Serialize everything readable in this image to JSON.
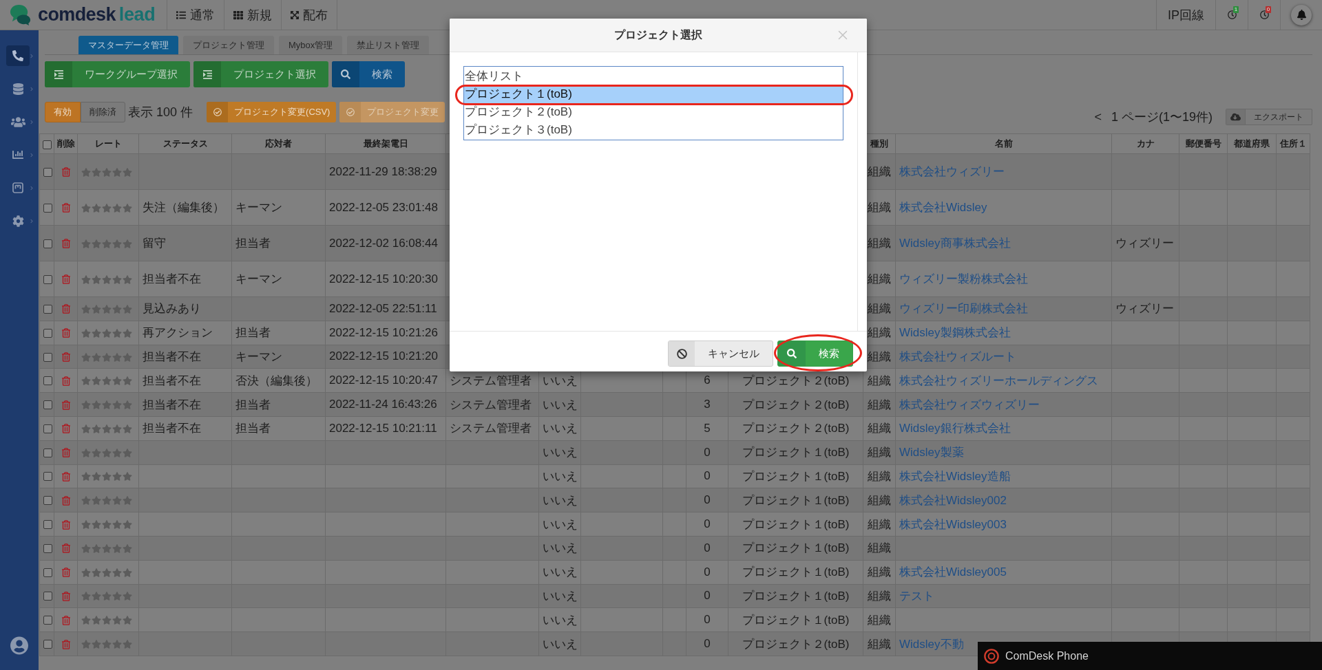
{
  "header": {
    "logo": {
      "brand": "comdesk",
      "product": "lead"
    },
    "nav": [
      {
        "label": "通常"
      },
      {
        "label": "新規"
      },
      {
        "label": "配布"
      }
    ],
    "line_button": "IP回線",
    "timers": [
      {
        "count": "1",
        "color": "#2f8f3f"
      },
      {
        "count": "0",
        "color": "#b53131"
      }
    ]
  },
  "sidebar": {
    "items": [
      {
        "selected": true
      },
      {
        "selected": false
      },
      {
        "selected": false
      },
      {
        "selected": false
      },
      {
        "selected": false
      },
      {
        "selected": false
      }
    ]
  },
  "tabs": [
    {
      "label": "マスターデータ管理",
      "selected": true
    },
    {
      "label": "プロジェクト管理",
      "selected": false
    },
    {
      "label": "Mybox管理",
      "selected": false
    },
    {
      "label": "禁止リスト管理",
      "selected": false
    }
  ],
  "toolbar": {
    "buttons": [
      {
        "label": "ワークグループ選択",
        "kind": "select"
      },
      {
        "label": "プロジェクト選択",
        "kind": "select"
      },
      {
        "label": "検索",
        "kind": "search"
      }
    ]
  },
  "filter_bar": {
    "record_states": [
      {
        "label": "有効",
        "selected": true
      },
      {
        "label": "削除済",
        "selected": false
      }
    ],
    "page_size": "表示 100 件",
    "actions": [
      {
        "label": "プロジェクト変更(CSV)",
        "disabled": false
      },
      {
        "label": "プロジェクト変更",
        "disabled": true
      }
    ],
    "pagination": {
      "prev": "<",
      "label": "1 ページ(1〜19件)"
    },
    "export": "エクスポート"
  },
  "table": {
    "select_all": {
      "checked": false
    },
    "columns": [
      "削除",
      "レート",
      "ステータス",
      "応対者",
      "最終架電日",
      "種別",
      "名前",
      "カナ",
      "郵便番号",
      "都道府県",
      "住所１"
    ],
    "rows": [
      {
        "checked": false,
        "stars": 0,
        "last_call": "2022-11-29 18:38:29",
        "type": "組織",
        "name": "株式会社ウィズリー"
      },
      {
        "checked": false,
        "stars": 0,
        "status": "失注（編集後）",
        "responder": "キーマン",
        "last_call": "2022-12-05 23:01:48",
        "type": "組織",
        "name": "株式会社Widsley"
      },
      {
        "checked": false,
        "stars": 0,
        "status": "留守",
        "responder": "担当者",
        "last_call": "2022-12-02 16:08:44",
        "type": "組織",
        "name": "Widsley商事株式会社",
        "kana": "ウィズリー"
      },
      {
        "checked": false,
        "stars": 0,
        "status": "担当者不在",
        "responder": "キーマン",
        "last_call": "2022-12-15 10:20:30",
        "type": "組織",
        "name": "ウィズリー製粉株式会社"
      },
      {
        "checked": false,
        "stars": 0,
        "status": "見込みあり",
        "last_call": "2022-12-05 22:51:11",
        "type": "組織",
        "name": "ウィズリー印刷株式会社",
        "kana": "ウィズリー"
      },
      {
        "checked": false,
        "stars": 0,
        "status": "再アクション",
        "responder": "担当者",
        "last_call": "2022-12-15 10:21:26",
        "type": "組織",
        "name": "Widsley製鋼株式会社"
      },
      {
        "checked": false,
        "stars": 0,
        "status": "担当者不在",
        "responder": "キーマン",
        "last_call": "2022-12-15 10:21:20",
        "type": "組織",
        "name": "株式会社ウィズルート"
      },
      {
        "checked": false,
        "stars": 0,
        "status": "担当者不在",
        "responder": "否決（編集後）",
        "last_call": "2022-12-15 10:20:47",
        "column_7": "システム管理者",
        "column_8": "いいえ",
        "column_11": "6",
        "column_12": "プロジェクト２(toB)",
        "type": "組織",
        "name": "株式会社ウィズリーホールディングス"
      },
      {
        "checked": false,
        "stars": 0,
        "status": "担当者不在",
        "responder": "担当者",
        "last_call": "2022-11-24 16:43:26",
        "column_7": "システム管理者",
        "column_8": "いいえ",
        "column_11": "3",
        "column_12": "プロジェクト２(toB)",
        "type": "組織",
        "name": "株式会社ウィズウィズリー"
      },
      {
        "checked": false,
        "stars": 0,
        "status": "担当者不在",
        "responder": "担当者",
        "last_call": "2022-12-15 10:21:11",
        "column_7": "システム管理者",
        "column_8": "いいえ",
        "column_11": "5",
        "column_12": "プロジェクト２(toB)",
        "type": "組織",
        "name": "Widsley銀行株式会社"
      },
      {
        "checked": false,
        "stars": 0,
        "column_8": "いいえ",
        "column_11": "0",
        "column_12": "プロジェクト１(toB)",
        "type": "組織",
        "name": "Widsley製薬"
      },
      {
        "checked": false,
        "stars": 0,
        "column_8": "いいえ",
        "column_11": "0",
        "column_12": "プロジェクト１(toB)",
        "type": "組織",
        "name": "株式会社Widsley造船"
      },
      {
        "checked": false,
        "stars": 0,
        "column_8": "いいえ",
        "column_11": "0",
        "column_12": "プロジェクト１(toB)",
        "type": "組織",
        "name": "株式会社Widsley002"
      },
      {
        "checked": false,
        "stars": 0,
        "column_8": "いいえ",
        "column_11": "0",
        "column_12": "プロジェクト１(toB)",
        "type": "組織",
        "name": "株式会社Widsley003"
      },
      {
        "checked": false,
        "stars": 0,
        "column_8": "いいえ",
        "column_11": "0",
        "column_12": "プロジェクト１(toB)",
        "type": "組織"
      },
      {
        "checked": false,
        "stars": 0,
        "column_8": "いいえ",
        "column_11": "0",
        "column_12": "プロジェクト１(toB)",
        "type": "組織",
        "name": "株式会社Widsley005"
      },
      {
        "checked": false,
        "stars": 0,
        "column_8": "いいえ",
        "column_11": "0",
        "column_12": "プロジェクト１(toB)",
        "type": "組織",
        "name": "テスト"
      },
      {
        "checked": false,
        "stars": 0,
        "column_8": "いいえ",
        "column_11": "0",
        "column_12": "プロジェクト１(toB)",
        "type": "組織"
      },
      {
        "checked": false,
        "stars": 0,
        "column_8": "いいえ",
        "column_11": "0",
        "column_12": "プロジェクト２(toB)",
        "type": "組織",
        "name": "Widsley不動"
      }
    ]
  },
  "dialog": {
    "title": "プロジェクト選択",
    "options": [
      {
        "label": "全体リスト",
        "selected": false,
        "highlighted": false
      },
      {
        "label": "プロジェクト１(toB)",
        "selected": true,
        "highlighted": true
      },
      {
        "label": "プロジェクト２(toB)",
        "selected": false,
        "highlighted": false
      },
      {
        "label": "プロジェクト３(toB)",
        "selected": false,
        "highlighted": false
      }
    ],
    "buttons": [
      {
        "label": "キャンセル",
        "kind": "cancel",
        "highlighted": false
      },
      {
        "label": "検索",
        "kind": "search",
        "highlighted": true
      }
    ]
  },
  "phone_widget": {
    "title": "ComDesk Phone"
  }
}
